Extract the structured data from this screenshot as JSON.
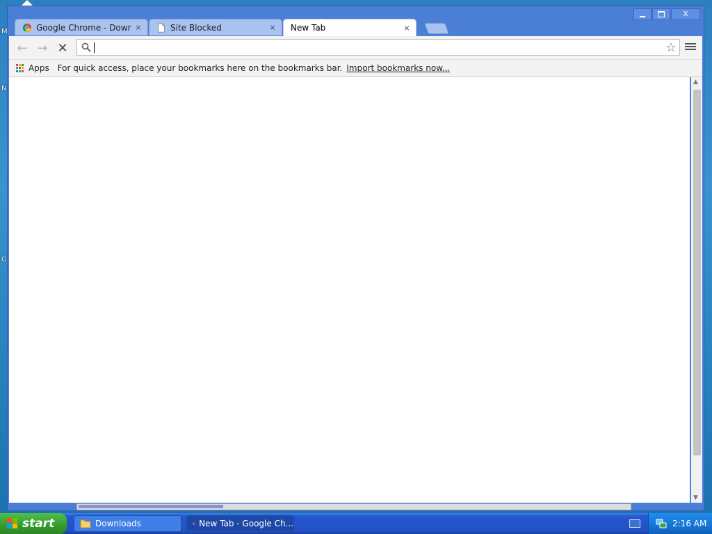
{
  "browser": {
    "tabs": [
      {
        "title": "Google Chrome - Download t",
        "icon": "chrome-logo-icon",
        "active": false
      },
      {
        "title": "Site Blocked",
        "icon": "page-icon",
        "active": false
      },
      {
        "title": "New Tab",
        "icon": null,
        "active": true
      }
    ],
    "tab_close_glyph": "×",
    "window_controls": {
      "minimize": "—",
      "maximize": "▫",
      "close": "X"
    },
    "omnibox": {
      "value": "",
      "placeholder": ""
    },
    "bookmarks_bar": {
      "apps_label": "Apps",
      "message": "For quick access, place your bookmarks here on the bookmarks bar.",
      "import_link": "Import bookmarks now..."
    }
  },
  "taskbar": {
    "start_label": "start",
    "items": [
      {
        "label": "Downloads",
        "icon": "folder-icon",
        "active": false
      },
      {
        "label": "New Tab - Google Ch...",
        "icon": "chrome-logo-icon",
        "active": true
      }
    ],
    "clock": "2:16 AM"
  },
  "desktop": {
    "icon_letters": [
      "M",
      "N",
      "G"
    ]
  },
  "colors": {
    "titlebar_blue": "#4b7fd6",
    "taskbar_blue": "#2350c6",
    "start_green": "#339c2d",
    "tray_blue": "#1575d6"
  }
}
